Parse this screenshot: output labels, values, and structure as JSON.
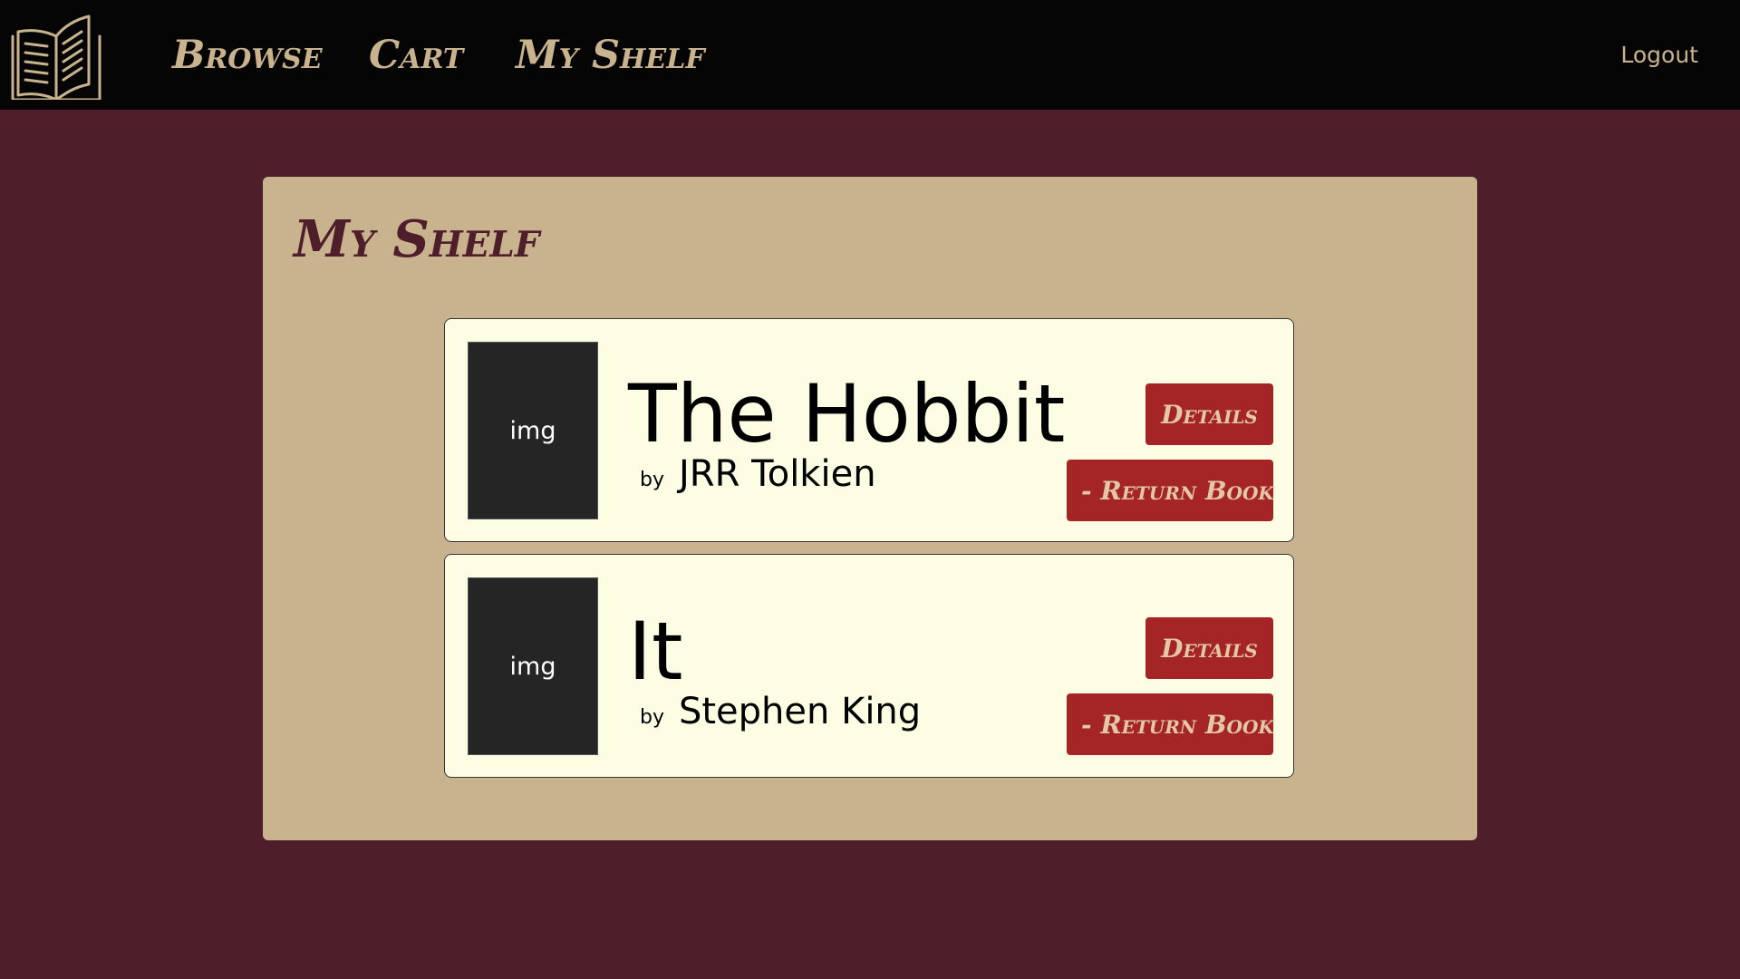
{
  "nav": {
    "logo_icon": "open-book-icon",
    "links": [
      "Browse",
      "Cart",
      "My Shelf"
    ],
    "logout": "Logout"
  },
  "page": {
    "title": "My Shelf"
  },
  "books": [
    {
      "cover_placeholder": "img",
      "title": "The Hobbit",
      "by": "by",
      "author": "JRR Tolkien",
      "details_label": "Details",
      "return_label": "- Return Book"
    },
    {
      "cover_placeholder": "img",
      "title": "It",
      "by": "by",
      "author": "Stephen King",
      "details_label": "Details",
      "return_label": "- Return Book"
    }
  ],
  "colors": {
    "background": "#4e1e2a",
    "topbar": "#040504",
    "panel": "#c9b38e",
    "card": "#fcfde2",
    "button": "#a52526",
    "accent_text": "#c9b38e"
  }
}
